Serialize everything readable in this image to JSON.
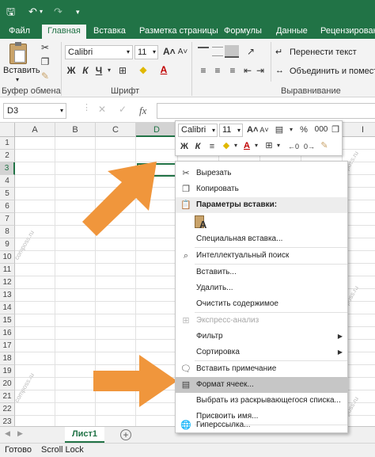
{
  "ribbon_tabs": [
    "Файл",
    "Главная",
    "Вставка",
    "Разметка страницы",
    "Формулы",
    "Данные",
    "Рецензирование"
  ],
  "ribbon": {
    "paste_label": "Вставить",
    "clipboard_group": "Буфер обмена",
    "font_name": "Calibri",
    "font_size": "11",
    "font_group": "Шрифт",
    "wrap_text": "Перенести текст",
    "merge_center": "Объединить и поместить",
    "alignment_group": "Выравнивание",
    "bold": "Ж",
    "italic": "К",
    "underline": "Ч"
  },
  "formula_bar": {
    "name_box": "D3",
    "fx": "fx",
    "formula": ""
  },
  "grid": {
    "columns": [
      "A",
      "B",
      "C",
      "D",
      "E",
      "F",
      "G",
      "H",
      "I"
    ],
    "rows": [
      "1",
      "2",
      "3",
      "4",
      "5",
      "6",
      "7",
      "8",
      "9",
      "10",
      "11",
      "12",
      "13",
      "14",
      "15",
      "16",
      "17",
      "18",
      "19",
      "20",
      "21",
      "22",
      "23"
    ],
    "selected_cell": "D3"
  },
  "mini_toolbar": {
    "font": "Calibri",
    "size": "11",
    "percent": "%",
    "thousands": "000"
  },
  "context_menu": {
    "items": [
      {
        "label": "Вырезать",
        "icon": "scissors-icon"
      },
      {
        "label": "Копировать",
        "icon": "copy-icon"
      },
      {
        "label": "Параметры вставки:",
        "icon": "paste-icon"
      },
      {
        "label": "Специальная вставка...",
        "icon": ""
      },
      {
        "label": "Интеллектуальный поиск",
        "icon": "search-icon"
      },
      {
        "label": "Вставить...",
        "icon": ""
      },
      {
        "label": "Удалить...",
        "icon": ""
      },
      {
        "label": "Очистить содержимое",
        "icon": ""
      },
      {
        "label": "Экспресс-анализ",
        "icon": "quick-analysis-icon"
      },
      {
        "label": "Фильтр",
        "icon": ""
      },
      {
        "label": "Сортировка",
        "icon": ""
      },
      {
        "label": "Вставить примечание",
        "icon": "comment-icon"
      },
      {
        "label": "Формат ячеек...",
        "icon": "format-cells-icon"
      },
      {
        "label": "Выбрать из раскрывающегося списка...",
        "icon": ""
      },
      {
        "label": "Присвоить имя...",
        "icon": ""
      },
      {
        "label": "Гиперссылка...",
        "icon": "hyperlink-icon"
      }
    ]
  },
  "sheet_tab": "Лист1",
  "status": {
    "ready": "Готово",
    "scroll_lock": "Scroll Lock"
  },
  "watermark": "composs.ru",
  "colors": {
    "excel_green": "#217346",
    "annotation_arrow": "#f0963c"
  }
}
